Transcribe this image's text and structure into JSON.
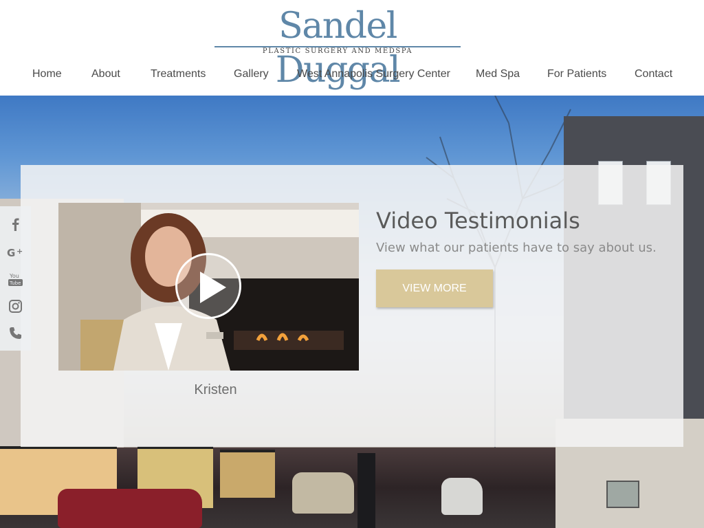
{
  "logo": {
    "name": "Sandel Duggal",
    "tagline": "PLASTIC SURGERY AND MEDSPA"
  },
  "nav": {
    "items": [
      {
        "label": "Home"
      },
      {
        "label": "About"
      },
      {
        "label": "Treatments"
      },
      {
        "label": "Gallery"
      },
      {
        "label": "West Annapolis Surgery Center"
      },
      {
        "label": "Med Spa"
      },
      {
        "label": "For Patients"
      },
      {
        "label": "Contact"
      }
    ]
  },
  "testimonial": {
    "title": "Video Testimonials",
    "subtitle": "View what our patients have to say about us.",
    "button_label": "VIEW MORE",
    "video_caption": "Kristen"
  },
  "social": {
    "icons": [
      {
        "name": "facebook-icon",
        "glyph": "f"
      },
      {
        "name": "google-plus-icon",
        "glyph": "G+"
      },
      {
        "name": "youtube-icon",
        "glyph": "You Tube"
      },
      {
        "name": "instagram-icon",
        "glyph": ""
      },
      {
        "name": "phone-icon",
        "glyph": ""
      }
    ]
  },
  "colors": {
    "brand_blue": "#5f87a8",
    "nav_text": "#4a4a4a",
    "button_gold": "#d9c89a",
    "panel_bg": "#f4f4f4"
  }
}
